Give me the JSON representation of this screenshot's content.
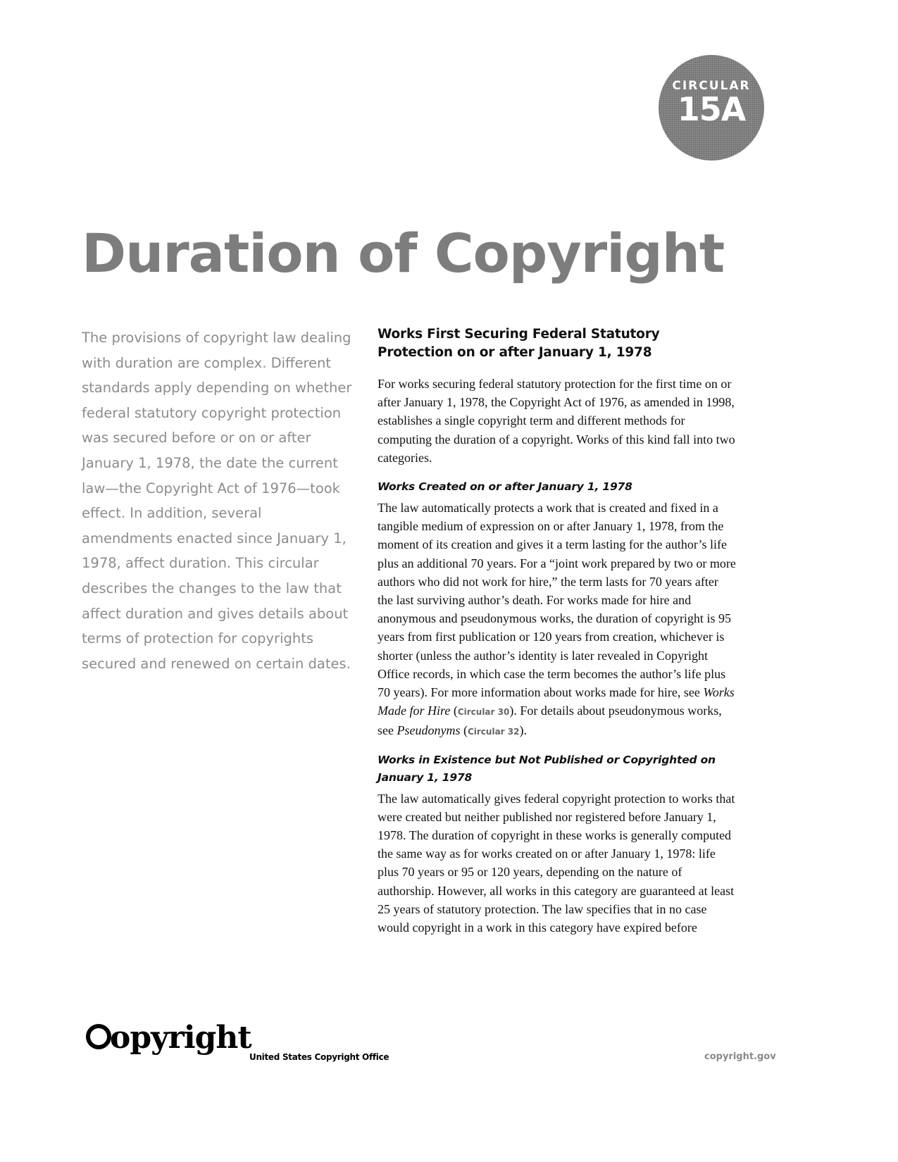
{
  "badge": {
    "label": "CIRCULAR",
    "number": "15A"
  },
  "title": "Duration of Copyright",
  "intro": "The provisions of copyright law dealing with duration are complex. Different standards apply depending on whether federal statutory copyright protection was secured before or on or after January 1, 1978, the date the current law—the Copyright Act of 1976—took effect. In addition, several amendments enacted since January 1, 1978, affect duration. This circular describes the changes to the law that affect duration and gives details about terms of protection for copyrights secured and renewed on certain dates.",
  "main": {
    "heading": "Works First Securing Federal Statutory Protection on or after January 1, 1978",
    "lead": "For works securing federal statutory protection for the first time on or after January 1, 1978, the Copyright Act of 1976, as amended in 1998, establishes a single copyright term and different methods for computing the duration of a copyright. Works of this kind fall into two categories.",
    "sections": [
      {
        "heading": "Works Created on or after January 1, 1978",
        "body_1": "The law automatically protects a work that is created and fixed in a tangible medium of expression on or after January 1, 1978, from the moment of its creation and gives it a term lasting for the author’s life plus an additional 70 years. For a “joint work prepared by two or more authors who did not work for hire,” the term lasts for 70 years after the last surviving author’s death. For works made for hire and anonymous and pseudonymous works, the duration of copyright is 95 years from first publication or 120 years from creation, whichever is shorter (unless the author’s identity is later revealed in Copyright Office records, in which case the term becomes the author’s life plus 70 years). For more information about works made for hire, see ",
        "link_1": "Works Made for Hire",
        "circ_1": "Circular 30",
        "body_2": ". For details about pseudonymous works, see ",
        "link_2": "Pseudonyms",
        "circ_2": "Circular 32",
        "body_3": "."
      },
      {
        "heading": "Works in Existence but Not Published or Copyrighted on January 1, 1978",
        "body": "The law automatically gives federal copyright protection to works that were created but neither published nor registered before January 1, 1978. The duration of copyright in these works is generally computed the same way as for works created on or after January 1, 1978: life plus 70 years or 95 or 120 years, depending on the nature of authorship. However, all works in this category are guaranteed at least 25 years of statutory protection. The law specifies that in no case would copyright in a work in this category have expired before"
      }
    ]
  },
  "footer": {
    "logo_text": "opyright",
    "office": "United States Copyright Office",
    "url": "copyright.gov"
  }
}
